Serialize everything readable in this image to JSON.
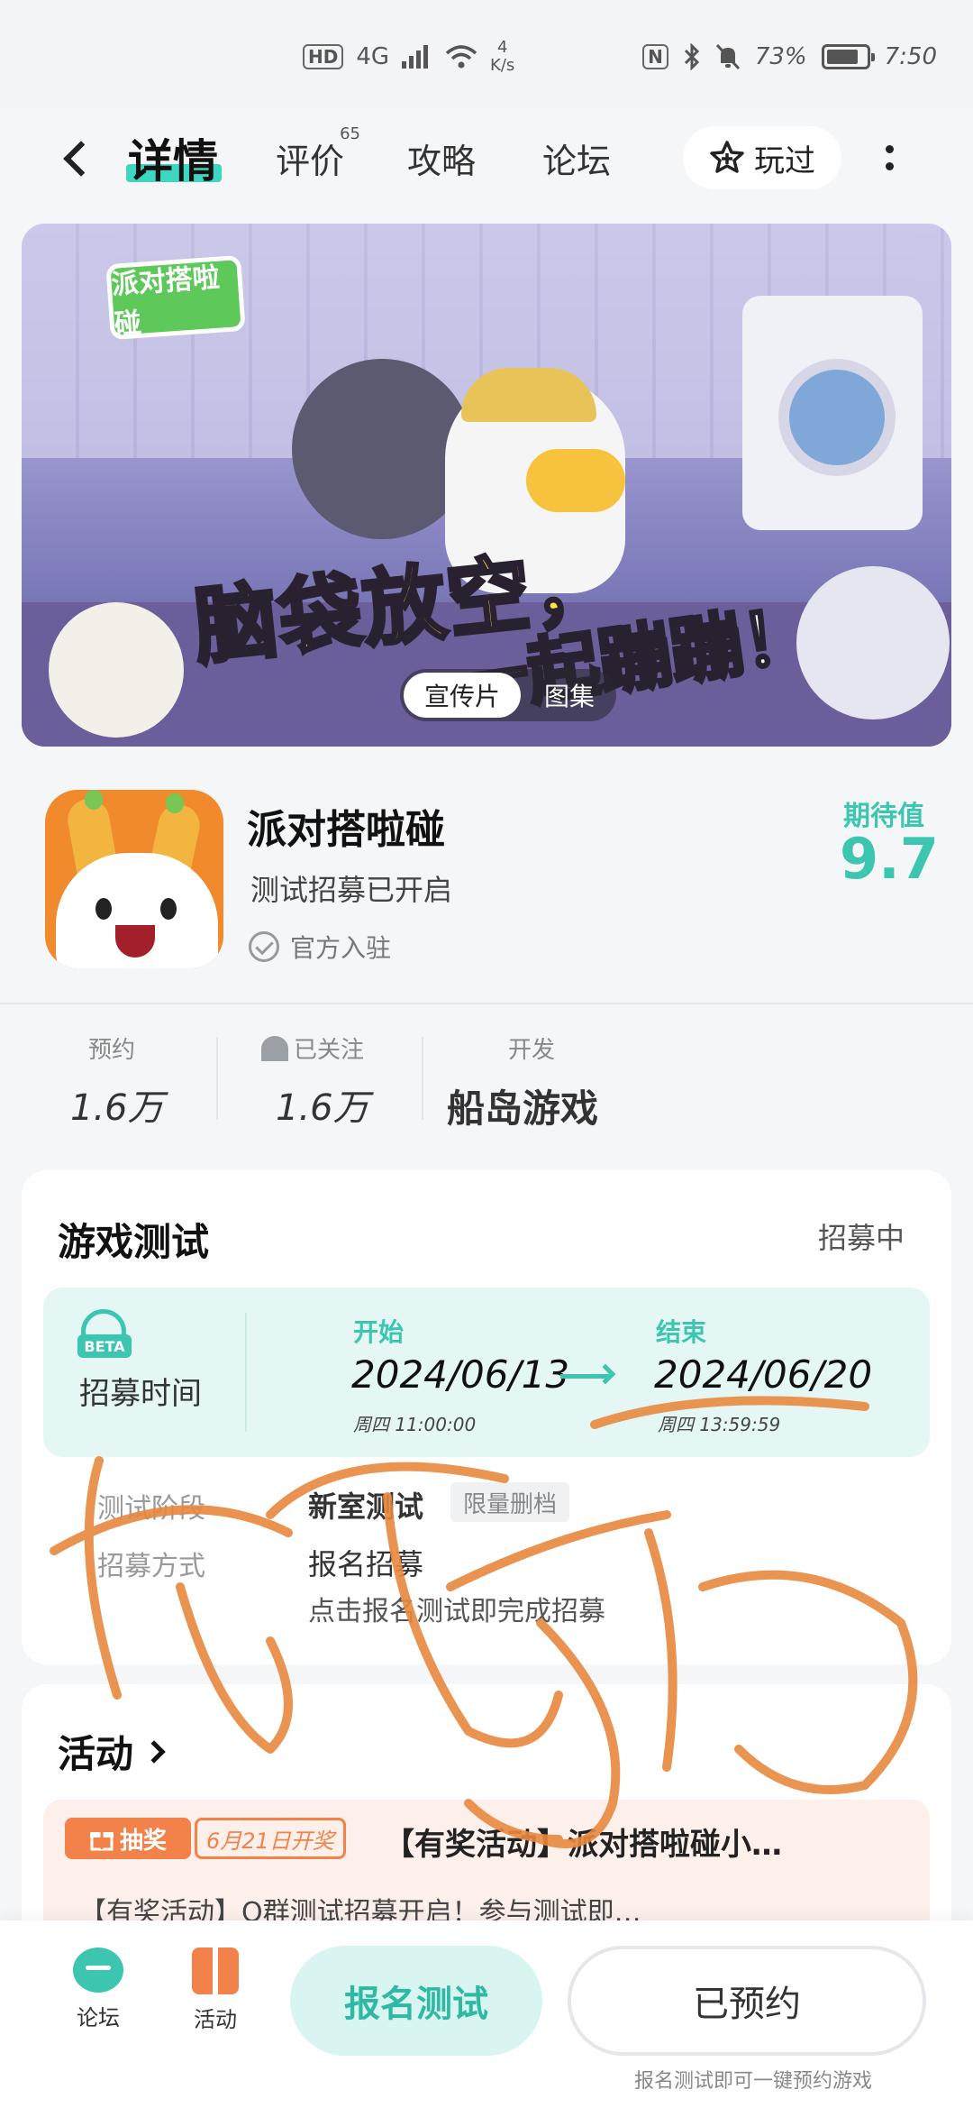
{
  "status_bar": {
    "hd": "HD",
    "network": "4G",
    "speed_value": "4",
    "speed_unit": "K/s",
    "nfc": "N",
    "battery": "73%",
    "time": "7:50"
  },
  "header": {
    "tabs": [
      {
        "label": "详情",
        "active": true
      },
      {
        "label": "评价",
        "badge": "65"
      },
      {
        "label": "攻略"
      },
      {
        "label": "论坛"
      }
    ],
    "played_label": "玩过"
  },
  "banner": {
    "logo_text": "派对搭啦碰",
    "slogan_line1": "脑袋放空，",
    "slogan_line2": "一起蹦蹦！",
    "toggle": [
      "宣传片",
      "图集"
    ]
  },
  "app": {
    "name": "派对搭啦碰",
    "status": "测试招募已开启",
    "official": "官方入驻",
    "expect_label": "期待值",
    "expect_value": "9.7"
  },
  "stats": {
    "reserve_label": "预约",
    "reserve_value": "1.6万",
    "follow_label": "已关注",
    "follow_value": "1.6万",
    "dev_label": "开发",
    "dev_value": "船岛游戏"
  },
  "test": {
    "title": "游戏测试",
    "status": "招募中",
    "beta": "BETA",
    "recruit_label": "招募时间",
    "start_label": "开始",
    "start_date": "2024/06/13",
    "start_sub": "周四 11:00:00",
    "end_label": "结束",
    "end_date": "2024/06/20",
    "end_sub": "周四 13:59:59",
    "stage_label": "测试阶段",
    "stage_value": "新室测试",
    "stage_badge": "限量删档",
    "method_label": "招募方式",
    "method_value": "报名招募",
    "method_desc": "点击报名测试即完成招募"
  },
  "activity": {
    "title": "活动",
    "draw_tag": "抽奖",
    "date_tag": "6月21日开奖",
    "headline": "【有奖活动】派对搭啦碰小…",
    "desc": "【有奖活动】Q群测试招募开启！参与测试即…"
  },
  "bottom": {
    "forum_label": "论坛",
    "activity_label": "活动",
    "signup_button": "报名测试",
    "reserved_button": "已预约",
    "note": "报名测试即可一键预约游戏"
  },
  "colors": {
    "accent": "#3cc6b0",
    "orange": "#f2814a",
    "background": "#f5f6f8"
  }
}
